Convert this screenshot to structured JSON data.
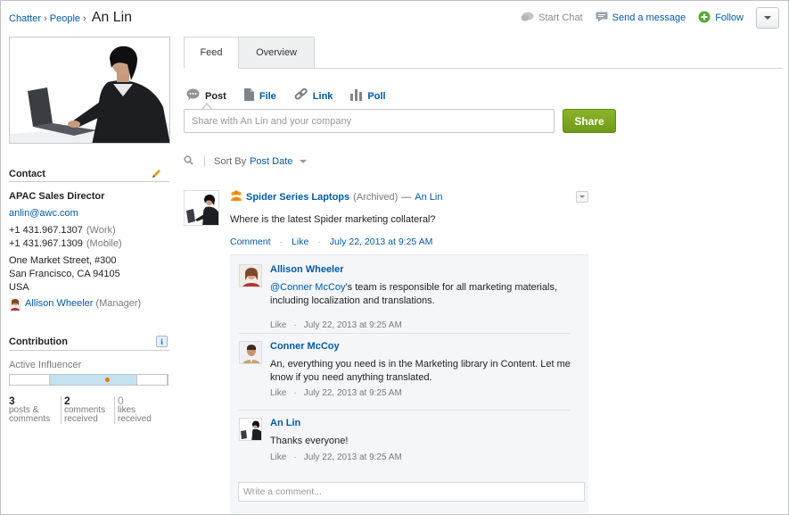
{
  "breadcrumb": {
    "chatter": "Chatter",
    "people": "People",
    "separator": "›",
    "current": "An Lin"
  },
  "header_actions": {
    "start_chat": "Start Chat",
    "send_message": "Send a message",
    "follow": "Follow",
    "icons": {
      "chat": "chat-bubble-icon",
      "message": "message-icon",
      "follow": "plus-circle-icon",
      "menu": "chevron-down-icon"
    },
    "colors": {
      "follow_green": "#5aa832",
      "disabled_grey": "#8a8a8a"
    }
  },
  "profile": {
    "contact_heading": "Contact",
    "title": "APAC Sales Director",
    "email": "anlin@awc.com",
    "phone_work": "+1 431.967.1307",
    "phone_work_label": "(Work)",
    "phone_mobile": "+1 431.967.1309",
    "phone_mobile_label": "(Mobile)",
    "address_line1": "One Market Street, #300",
    "address_line2": "San Francisco, CA 94105",
    "address_line3": "USA",
    "manager_name": "Allison Wheeler",
    "manager_label": "(Manager)"
  },
  "contribution": {
    "heading": "Contribution",
    "level_label": "Active Influencer",
    "level_fraction": 0.62,
    "info_icon": "info-icon",
    "stats": [
      {
        "value": "3",
        "line1": "posts &",
        "line2": "comments"
      },
      {
        "value": "2",
        "line1": "comments",
        "line2": "received"
      },
      {
        "value": "0",
        "line1": "likes",
        "line2": "received"
      }
    ]
  },
  "tabs": {
    "feed": "Feed",
    "overview": "Overview"
  },
  "publisher": {
    "post": "Post",
    "file": "File",
    "link": "Link",
    "poll": "Poll",
    "placeholder": "Share with An Lin and your company",
    "share": "Share",
    "share_color": "#7aa821"
  },
  "sort": {
    "label": "Sort By",
    "value": "Post Date"
  },
  "post": {
    "group": "Spider Series Laptops",
    "archived": "(Archived)",
    "dash": "—",
    "author": "An Lin",
    "body": "Where is the latest Spider marketing collateral?",
    "comment_action": "Comment",
    "like_action": "Like",
    "timestamp": "July 22, 2013 at 9:25 AM"
  },
  "comments": [
    {
      "author": "Allison Wheeler",
      "mention": "@Conner McCoy",
      "text": "'s team is responsible for all marketing materials, including localization and translations.",
      "like": "Like",
      "timestamp": "July 22, 2013 at 9:25 AM"
    },
    {
      "author": "Conner McCoy",
      "text": "An, everything you need is in the Marketing library in Content. Let me know if you need anything translated.",
      "like": "Like",
      "timestamp": "July 22, 2013 at 9:25 AM"
    },
    {
      "author": "An Lin",
      "text": "Thanks everyone!",
      "like": "Like",
      "timestamp": "July 22, 2013 at 9:25 AM"
    }
  ],
  "comment_input": {
    "placeholder": "Write a comment..."
  }
}
